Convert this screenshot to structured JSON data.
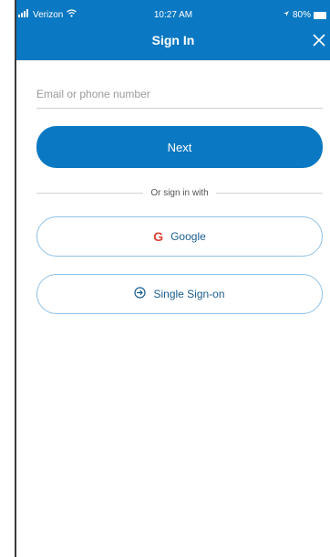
{
  "status_bar": {
    "carrier": "Verizon",
    "time": "10:27 AM",
    "battery": "80%"
  },
  "header": {
    "title": "Sign In"
  },
  "form": {
    "email_placeholder": "Email or phone number",
    "email_value": "",
    "next_label": "Next"
  },
  "divider": {
    "label": "Or sign in with"
  },
  "providers": {
    "google_label": "Google",
    "sso_label": "Single Sign-on"
  },
  "colors": {
    "primary": "#0a78c2",
    "outline": "#8fc1e6"
  }
}
